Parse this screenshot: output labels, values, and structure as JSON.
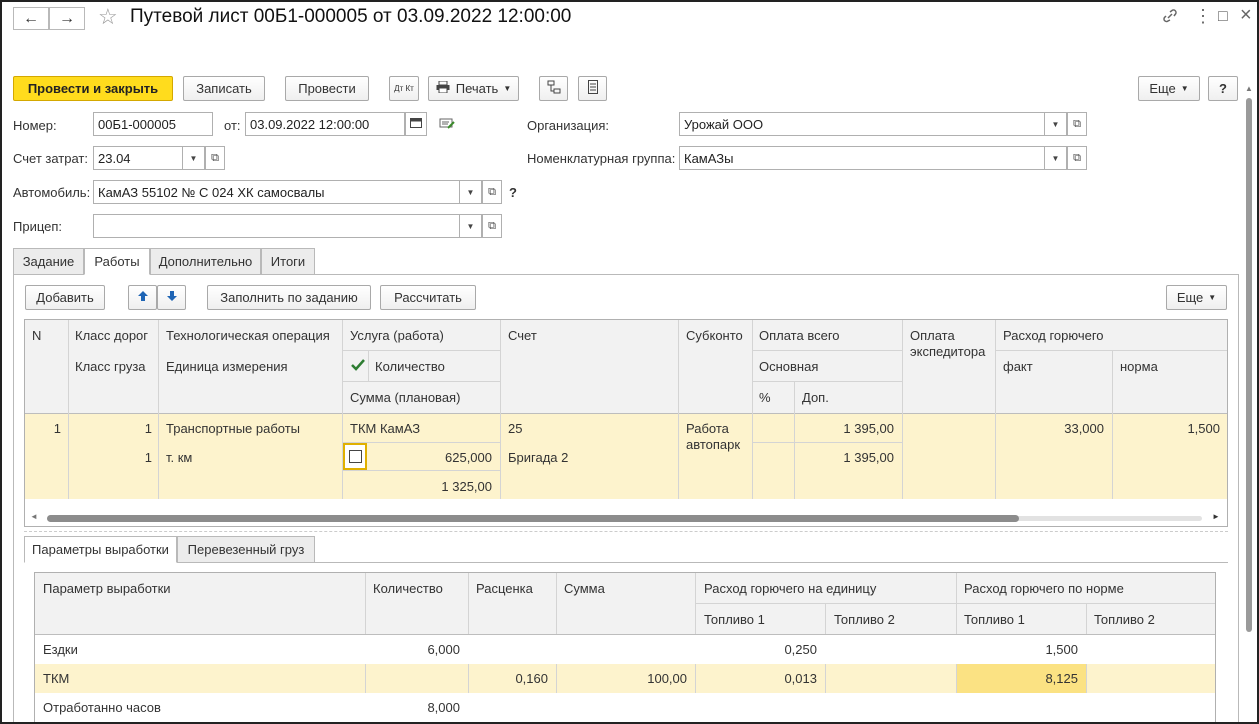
{
  "window": {
    "title": "Путевой лист 00Б1-000005 от 03.09.2022 12:00:00",
    "back_icon": "←",
    "forward_icon": "→",
    "star_icon": "☆",
    "link_icon": "🔗",
    "menu_icon": "⋮",
    "maximize_icon": "□",
    "close_icon": "×"
  },
  "toolbar": {
    "post_close": "Провести и закрыть",
    "save": "Записать",
    "post": "Провести",
    "dt_kt": "Дт Кт",
    "print": "Печать",
    "more": "Еще",
    "help": "?"
  },
  "form": {
    "number_label": "Номер:",
    "number_value": "00Б1-000005",
    "from_label": "от:",
    "date_value": "03.09.2022 12:00:00",
    "cost_account_label": "Счет затрат:",
    "cost_account_value": "23.04",
    "organization_label": "Организация:",
    "organization_value": "Урожай ООО",
    "nom_group_label": "Номенклатурная группа:",
    "nom_group_value": "КамАЗы",
    "car_label": "Автомобиль:",
    "car_value": "КамАЗ 55102 № С 024 ХК самосвалы",
    "car_help": "?",
    "trailer_label": "Прицеп:",
    "trailer_value": ""
  },
  "tabs": [
    "Задание",
    "Работы",
    "Дополнительно",
    "Итоги"
  ],
  "works_toolbar": {
    "add": "Добавить",
    "up_icon": "🡅",
    "down_icon": "🡇",
    "fill": "Заполнить по заданию",
    "calc": "Рассчитать",
    "more": "Еще"
  },
  "works_header": {
    "n": "N",
    "road_class": "Класс дорог",
    "cargo_class": "Класс груза",
    "tech_op": "Технологическая операция",
    "unit": "Единица измерения",
    "service": "Услуга (работа)",
    "qty": "Количество",
    "sum_plan": "Сумма (плановая)",
    "account": "Счет",
    "subconto": "Субконто",
    "pay_total": "Оплата всего",
    "pay_main": "Основная",
    "pay_pct": "%",
    "pay_add": "Доп.",
    "pay_forwarder": "Оплата экспедитора",
    "fuel": "Расход горючего",
    "fuel_fact": "факт",
    "fuel_norm": "норма"
  },
  "works_row": {
    "n": "1",
    "road_class": "1",
    "cargo_class": "1",
    "tech_op": "Транспортные работы",
    "unit": "т. км",
    "service": "ТКМ КамАЗ",
    "qty": "625,000",
    "sum_plan": "1 325,00",
    "account": "25",
    "subconto1": "Бригада 2",
    "subconto": "Работа автопарк",
    "pay_total": "1 395,00",
    "pay_main": "1 395,00",
    "fuel_fact": "33,000",
    "fuel_norm": "1,500"
  },
  "bottom_tabs": [
    "Параметры выработки",
    "Перевезенный груз"
  ],
  "params_header": {
    "param": "Параметр выработки",
    "qty": "Количество",
    "rate": "Расценка",
    "sum": "Сумма",
    "fuel_unit": "Расход горючего на единицу",
    "fuel_norm": "Расход горючего по норме",
    "fuel1": "Топливо 1",
    "fuel2": "Топливо 2"
  },
  "params_rows": [
    {
      "name": "Ездки",
      "qty": "6,000",
      "rate": "",
      "sum": "",
      "fu1": "0,250",
      "fu2": "",
      "fn1": "1,500",
      "fn2": ""
    },
    {
      "name": "ТКМ",
      "qty": "",
      "rate": "0,160",
      "sum": "100,00",
      "fu1": "0,013",
      "fu2": "",
      "fn1": "8,125",
      "fn2": ""
    },
    {
      "name": "Отработанно часов",
      "qty": "8,000",
      "rate": "",
      "sum": "",
      "fu1": "",
      "fu2": "",
      "fn1": "",
      "fn2": ""
    }
  ]
}
